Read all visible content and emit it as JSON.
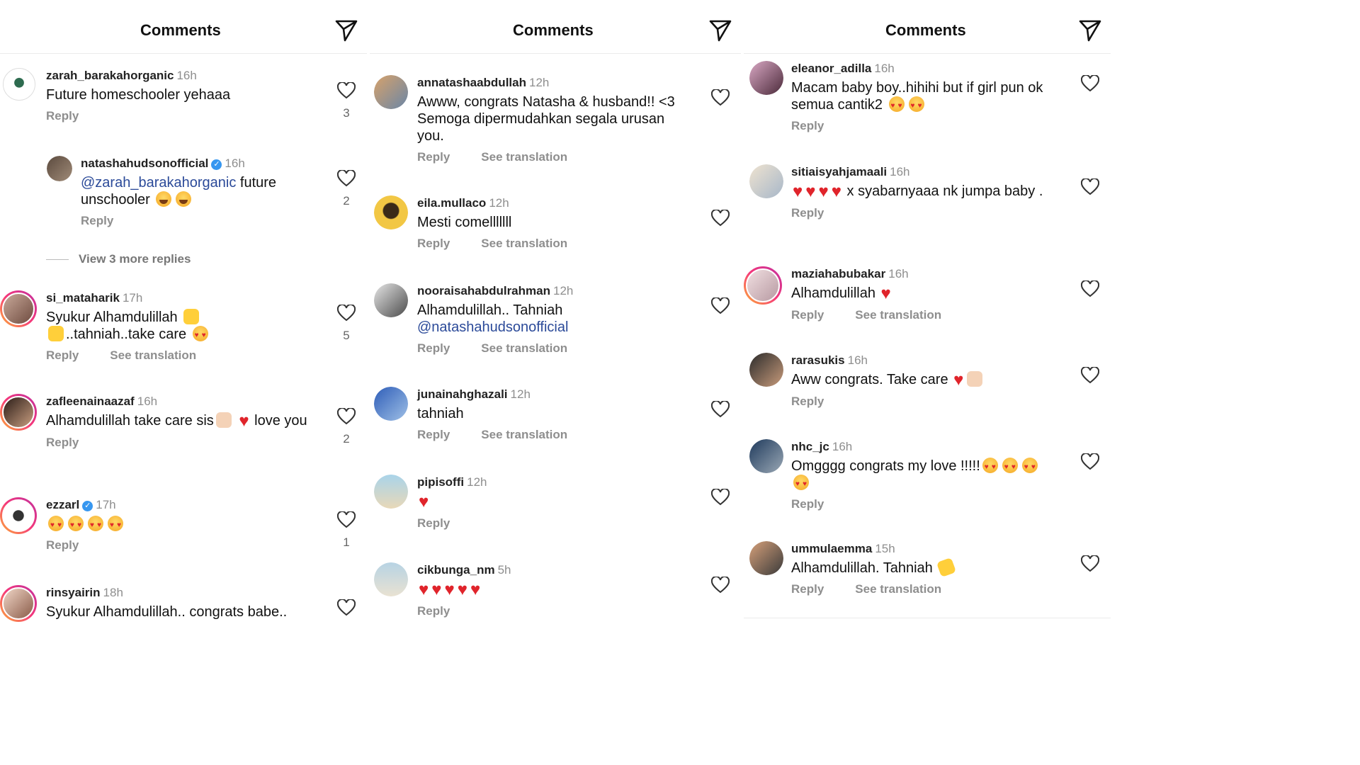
{
  "panels": [
    {
      "title": "Comments",
      "comments": [
        {
          "user": "zarah_barakahorganic",
          "time": "16h",
          "verified": false,
          "text": "Future homeschooler yehaaa",
          "likes": "3",
          "actions": [
            "Reply"
          ]
        },
        {
          "user": "natashahudsonofficial",
          "time": "16h",
          "verified": true,
          "mention": "@zarah_barakahorganic",
          "text": " future unschooler",
          "emoji": [
            "laugh",
            "laugh"
          ],
          "likes": "2",
          "actions": [
            "Reply"
          ]
        },
        {
          "user": "si_mataharik",
          "time": "17h",
          "verified": false,
          "text": "Syukur Alhamdulillah",
          "text2": "..tahniah..take care",
          "likes": "5",
          "actions": [
            "Reply",
            "See translation"
          ]
        },
        {
          "user": "zafleenainaazaf",
          "time": "16h",
          "verified": false,
          "text": "Alhamdulillah take care sis",
          "text2": " love you",
          "likes": "2",
          "actions": [
            "Reply"
          ]
        },
        {
          "user": "ezzarl",
          "time": "17h",
          "verified": true,
          "text": "",
          "likes": "1",
          "actions": [
            "Reply"
          ]
        },
        {
          "user": "rinsyairin",
          "time": "18h",
          "verified": false,
          "text": "Syukur Alhamdulillah.. congrats babe..",
          "actions": []
        }
      ],
      "more_replies": "View 3 more replies"
    },
    {
      "title": "Comments",
      "comments": [
        {
          "user": "annatashaabdullah",
          "time": "12h",
          "text": "Awww, congrats Natasha & husband!! <3 Semoga dipermudahkan segala urusan you.",
          "actions": [
            "Reply",
            "See translation"
          ]
        },
        {
          "user": "eila.mullaco",
          "time": "12h",
          "text": "Mesti comelllllll",
          "actions": [
            "Reply",
            "See translation"
          ]
        },
        {
          "user": "nooraisahabdulrahman",
          "time": "12h",
          "text": "Alhamdulillah.. Tahniah",
          "mention": "@natashahudsonofficial",
          "actions": [
            "Reply",
            "See translation"
          ]
        },
        {
          "user": "junainahghazali",
          "time": "12h",
          "text": "tahniah",
          "actions": [
            "Reply",
            "See translation"
          ]
        },
        {
          "user": "pipisoffi",
          "time": "12h",
          "text": "",
          "actions": [
            "Reply"
          ]
        },
        {
          "user": "cikbunga_nm",
          "time": "5h",
          "text": "",
          "actions": [
            "Reply"
          ]
        }
      ]
    },
    {
      "title": "Comments",
      "comments": [
        {
          "user": "eleanor_adilla",
          "time": "16h",
          "text": "Macam baby boy..hihihi but if girl pun ok semua cantik2",
          "actions": [
            "Reply"
          ]
        },
        {
          "user": "sitiaisyahjamaali",
          "time": "16h",
          "text": " x syabarnyaaa nk jumpa baby .",
          "actions": [
            "Reply"
          ]
        },
        {
          "user": "maziahabubakar",
          "time": "16h",
          "text": "Alhamdulillah",
          "actions": [
            "Reply",
            "See translation"
          ]
        },
        {
          "user": "rarasukis",
          "time": "16h",
          "text": "Aww congrats. Take care",
          "actions": [
            "Reply"
          ]
        },
        {
          "user": "nhc_jc",
          "time": "16h",
          "text": "Omgggg congrats my love !!!!!",
          "actions": [
            "Reply"
          ]
        },
        {
          "user": "ummulaemma",
          "time": "15h",
          "text": "Alhamdulillah. Tahniah",
          "actions": [
            "Reply",
            "See translation"
          ]
        }
      ]
    }
  ],
  "colors": {
    "mention": "#2b4a99",
    "meta": "#8e8e8e",
    "heart": "#e0242b",
    "verified": "#3797f0"
  },
  "icons": [
    "send-icon",
    "heart-outline-icon",
    "verified-badge-icon"
  ]
}
